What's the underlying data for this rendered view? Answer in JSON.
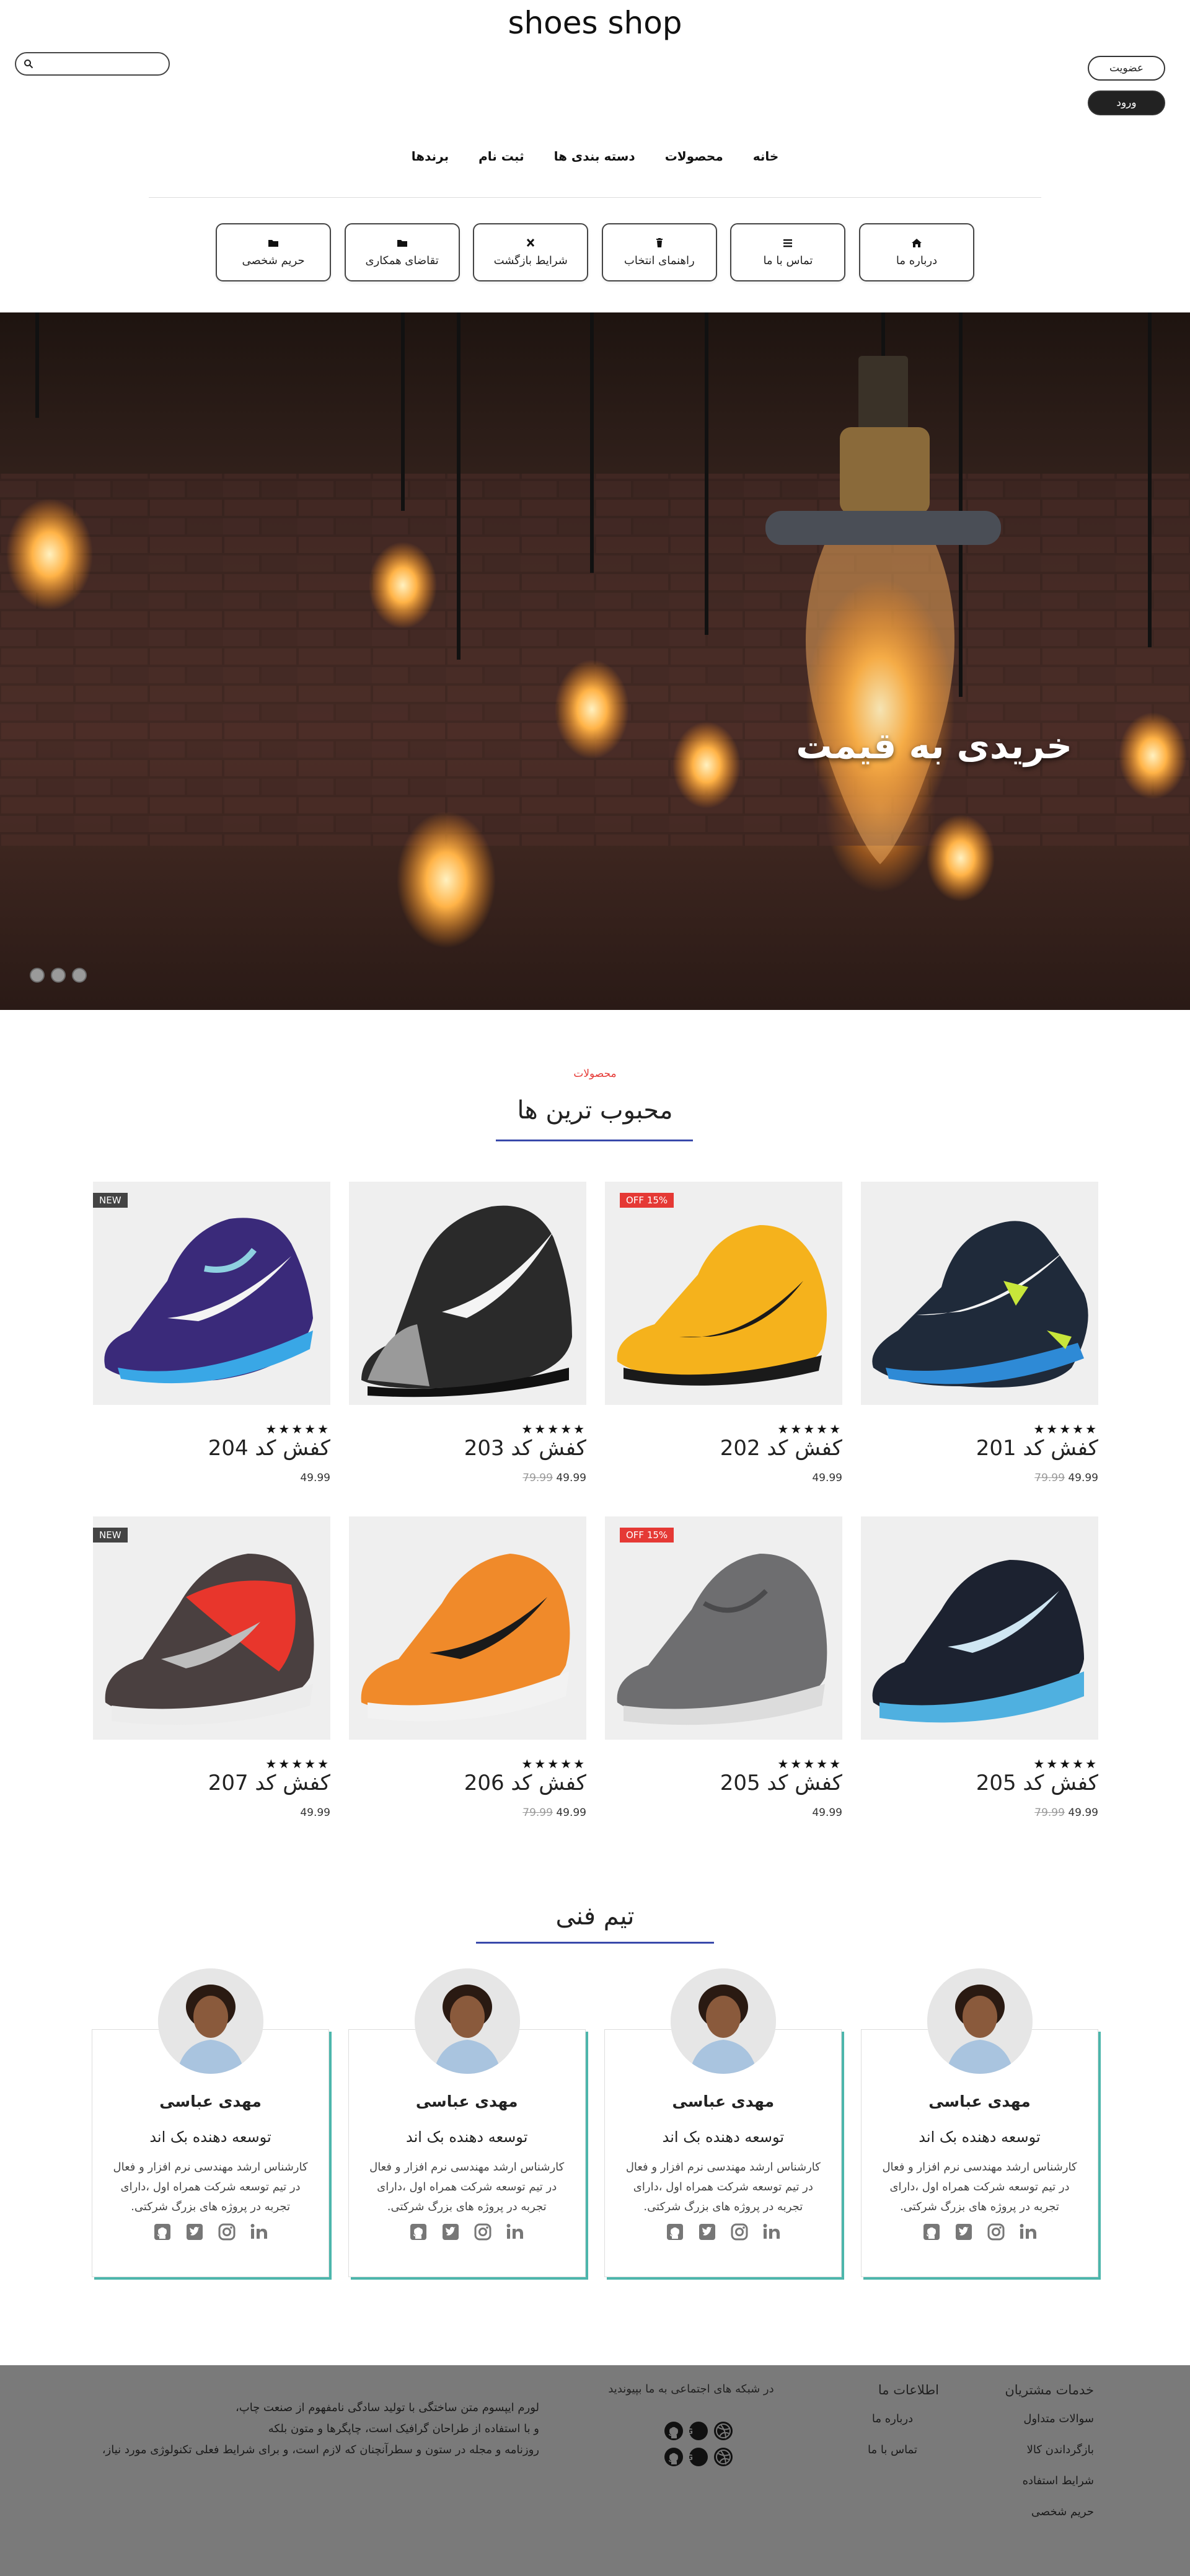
{
  "header": {
    "site_title": "shoes shop",
    "search_placeholder": "",
    "register_label": "عضویت",
    "login_label": "ورود"
  },
  "nav": {
    "items": [
      "خانه",
      "محصولات",
      "دسته بندی ها",
      "ثبت نام",
      "برندها"
    ]
  },
  "quick_links": [
    {
      "label": "درباره ما",
      "icon": "home-icon"
    },
    {
      "label": "تماس با ما",
      "icon": "menu-icon"
    },
    {
      "label": "راهنمای انتخاب",
      "icon": "trash-icon"
    },
    {
      "label": "شرایط بازگشت",
      "icon": "close-icon"
    },
    {
      "label": "تقاضای همکاری",
      "icon": "folder-icon"
    },
    {
      "label": "حریم شخصی",
      "icon": "folder-icon"
    }
  ],
  "hero": {
    "caption": "خریدی به قیمت",
    "slides": 3
  },
  "products_section": {
    "kicker": "محصولات",
    "title": "محبوب ترین ها",
    "items": [
      {
        "name": "کفش کد 201",
        "price": "49.99",
        "old_price": "79.99",
        "badge": "",
        "rating": 5
      },
      {
        "name": "کفش کد 202",
        "price": "49.99",
        "old_price": "",
        "badge": "OFF 15%",
        "rating": 5
      },
      {
        "name": "کفش کد 203",
        "price": "49.99",
        "old_price": "79.99",
        "badge": "",
        "rating": 5
      },
      {
        "name": "کفش کد 204",
        "price": "49.99",
        "old_price": "",
        "badge": "NEW",
        "rating": 5
      },
      {
        "name": "کفش کد 205",
        "price": "49.99",
        "old_price": "79.99",
        "badge": "",
        "rating": 5
      },
      {
        "name": "کفش کد 205",
        "price": "49.99",
        "old_price": "",
        "badge": "OFF 15%",
        "rating": 5
      },
      {
        "name": "کفش کد 206",
        "price": "49.99",
        "old_price": "79.99",
        "badge": "",
        "rating": 5
      },
      {
        "name": "کفش کد 207",
        "price": "49.99",
        "old_price": "",
        "badge": "NEW",
        "rating": 5
      }
    ],
    "stars_text": "★★★★★"
  },
  "team_section": {
    "title": "تیم فنی",
    "members": [
      {
        "name": "مهدی عباسی",
        "role": "توسعه دهنده بک اند",
        "bio": "کارشناس ارشد مهندسی نرم افزار و فعال در تیم توسعه شرکت همراه اول ،دارای تجربه در پروژه های بزرگ شرکتی."
      },
      {
        "name": "مهدی عباسی",
        "role": "توسعه دهنده بک اند",
        "bio": "کارشناس ارشد مهندسی نرم افزار و فعال در تیم توسعه شرکت همراه اول ،دارای تجربه در پروژه های بزرگ شرکتی."
      },
      {
        "name": "مهدی عباسی",
        "role": "توسعه دهنده بک اند",
        "bio": "کارشناس ارشد مهندسی نرم افزار و فعال در تیم توسعه شرکت همراه اول ،دارای تجربه در پروژه های بزرگ شرکتی."
      },
      {
        "name": "مهدی عباسی",
        "role": "توسعه دهنده بک اند",
        "bio": "کارشناس ارشد مهندسی نرم افزار و فعال در تیم توسعه شرکت همراه اول ،دارای تجربه در پروژه های بزرگ شرکتی."
      }
    ]
  },
  "footer": {
    "services_title": "خدمات مشتریان",
    "services_links": [
      "سوالات متداول",
      "بازگرداندن کالا",
      "شرایط استفاده",
      "حریم شخصی"
    ],
    "info_title": "اطلاعات ما",
    "info_links": [
      "درباره ما",
      "تماس با ما"
    ],
    "social_heading": "در شبکه های اجتماعی به ما بپیوندید",
    "about_lines": [
      "لورم ایپسوم متن ساختگی با تولید سادگی نامفهوم از صنعت چاپ،",
      "و با استفاده از طراحان گرافیک است، چاپگرها و متون بلکه",
      "روزنامه و مجله در ستون و سطرآنچنان که لازم است، و برای شرایط فعلی تکنولوژی مورد نیاز،"
    ]
  },
  "colors": {
    "accent_red": "#e53935",
    "underline_blue": "#3949ab",
    "card_shadow_teal": "#4db6ac",
    "footer_bg": "#7a7a7a"
  }
}
